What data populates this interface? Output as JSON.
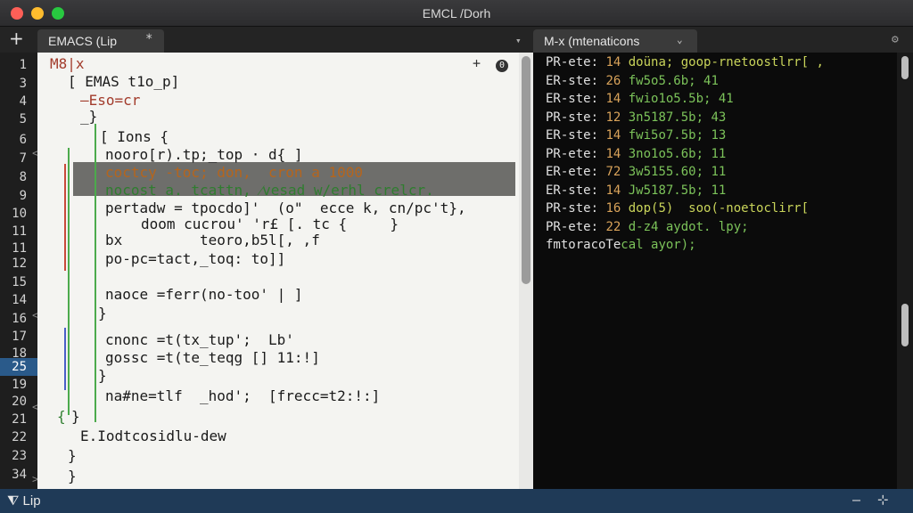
{
  "window": {
    "title": "EMCL /Dorh"
  },
  "tabs": {
    "add_label": "+",
    "left_label": "EMACS (Lip",
    "left_star": "*",
    "split_marker": "▾",
    "right_label": "M-x (mtenaticons",
    "right_chevron": "⌄",
    "settings_glyph": "⚙"
  },
  "gutter": {
    "lines": [
      "1",
      "3",
      "4",
      "5",
      "6",
      "7",
      "8",
      "9",
      "10",
      "11",
      "11",
      "12",
      "15",
      "14",
      "16",
      "17",
      "18",
      "25",
      "19",
      "20",
      "21",
      "22",
      "23",
      "34"
    ],
    "highlighted": "25"
  },
  "editor": {
    "ctrl_plus": "+",
    "ctrl_circle": "0",
    "lines": [
      "M8|x",
      "[ EMAS t1o_p]",
      "–Eso=cr",
      "_}",
      "[ Ions {",
      "nooro[r).tp;_top · d{ ]",
      "coctcy -toc; don,  cron a 1000",
      "nocost a. tcattn, ⁄vesad w/erhl crelcr.",
      "pertadw = tpocdo]'  (o\"  ecce k, cn/pc't},",
      "doom cucrou' 'r£ [. tc {     }",
      "bx         teoro,b5l[, ,f",
      "po-pc=tact,_toq: to]]",
      "naoce =ferr(no-too' | ]",
      "}",
      "cnonc =t(tx_tup';  Lb'",
      "gossc =t(te_teqg [] 11:!]",
      "}",
      "na#ne=tlf  _hod';  [frecc=t2:!:]",
      "}",
      "{",
      "E.Iodtcosidlu-dew",
      "}",
      "}"
    ]
  },
  "terminal": {
    "lines": [
      [
        "PR-ete: ",
        "14",
        " doüna; goop-rnetoostlrr[ ,"
      ],
      [
        "ER-ste: ",
        "26",
        " fw5o5.6b; 41"
      ],
      [
        "ER-ste: ",
        "14",
        " fwio1o5.5b; 41"
      ],
      [
        "PR-ste: ",
        "12",
        " 3n5187.5b; 43"
      ],
      [
        "ER-ste: ",
        "14",
        " fwi5o7.5b; 13"
      ],
      [
        "PR-ete: ",
        "14",
        " 3no1o5.6b; 11"
      ],
      [
        "ER-ete: ",
        "72",
        " 3w5155.60; 11"
      ],
      [
        "ER-ste: ",
        "14",
        " Jw5187.5b; 11"
      ],
      [
        "PR-ste: ",
        "16",
        " dop(5)  soo(-noetoclirr["
      ],
      [
        "PR-ete: ",
        "22",
        " d-z4 aydot. lpy;"
      ],
      [
        "fmtoracoTe",
        "",
        "cal ayor);"
      ]
    ]
  },
  "status": {
    "left": "⧨ Lip",
    "minimize": "–",
    "grid": "⊹"
  }
}
